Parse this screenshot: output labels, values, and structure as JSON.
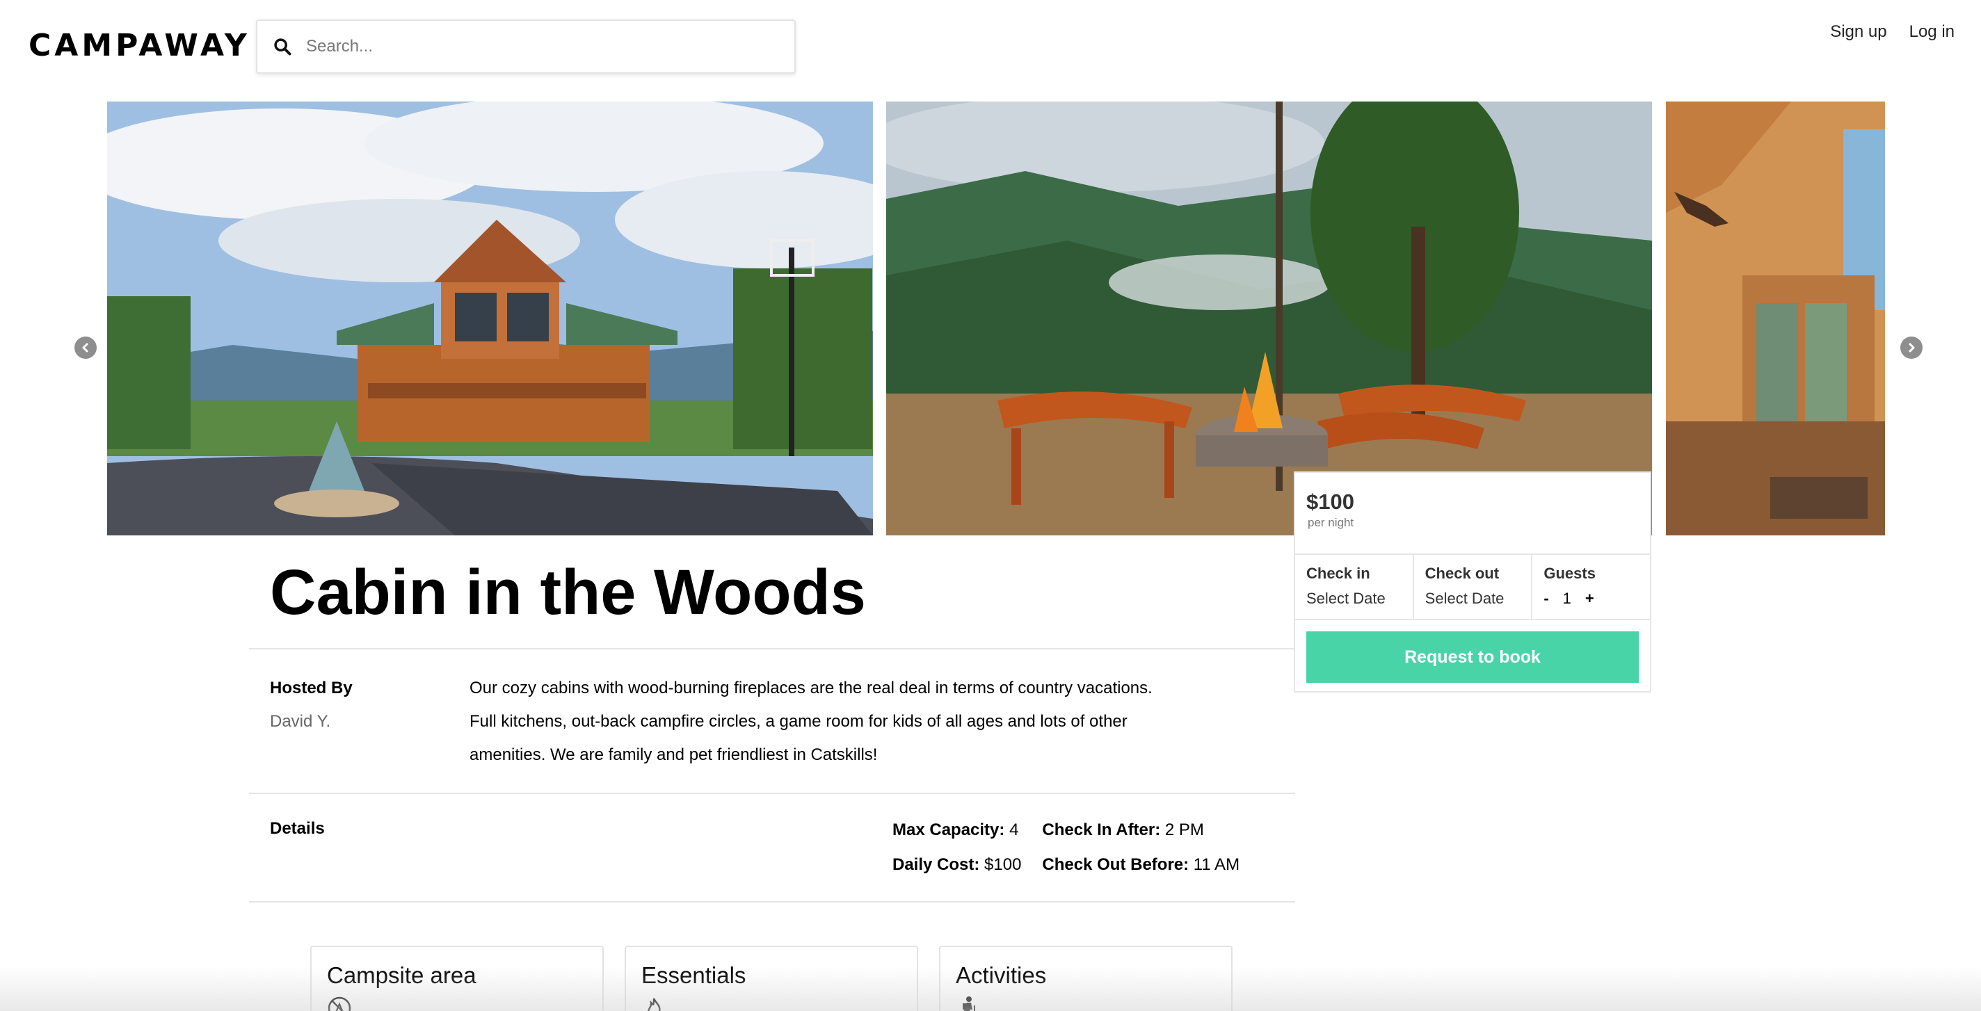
{
  "header": {
    "logo": "CAMPAWAY",
    "search_placeholder": "Search...",
    "sign_up": "Sign up",
    "log_in": "Log in"
  },
  "gallery": {
    "photos": [
      "photo-cabin-exterior",
      "photo-firepit-mountains",
      "photo-cabin-interior"
    ],
    "prev_icon": "chevron-left-icon",
    "next_icon": "chevron-right-icon"
  },
  "listing": {
    "title": "Cabin in the Woods",
    "hosted_by_label": "Hosted By",
    "host_name": "David Y.",
    "description": "Our cozy cabins with wood-burning fireplaces are the real deal in terms of country vacations. Full kitchens, out-back campfire circles, a game room for kids of all ages and lots of other amenities. We are family and pet friendliest in Catskills!",
    "details_label": "Details",
    "details": {
      "max_capacity_label": "Max Capacity:",
      "max_capacity_value": "4",
      "check_in_after_label": "Check In After:",
      "check_in_after_value": "2 PM",
      "daily_cost_label": "Daily Cost:",
      "daily_cost_value": "$100",
      "check_out_before_label": "Check Out Before:",
      "check_out_before_value": "11 AM"
    }
  },
  "amenities": [
    {
      "title": "Campsite area",
      "icon": "no-campfire-icon"
    },
    {
      "title": "Essentials",
      "icon": "flame-icon"
    },
    {
      "title": "Activities",
      "icon": "hiker-icon"
    }
  ],
  "booking": {
    "price": "$100",
    "per_night": "per night",
    "check_in_label": "Check in",
    "check_in_value": "Select Date",
    "check_out_label": "Check out",
    "check_out_value": "Select Date",
    "guests_label": "Guests",
    "guests_minus": "-",
    "guests_count": "1",
    "guests_plus": "+",
    "request_button": "Request to book",
    "accent_color": "#49d4a7"
  }
}
